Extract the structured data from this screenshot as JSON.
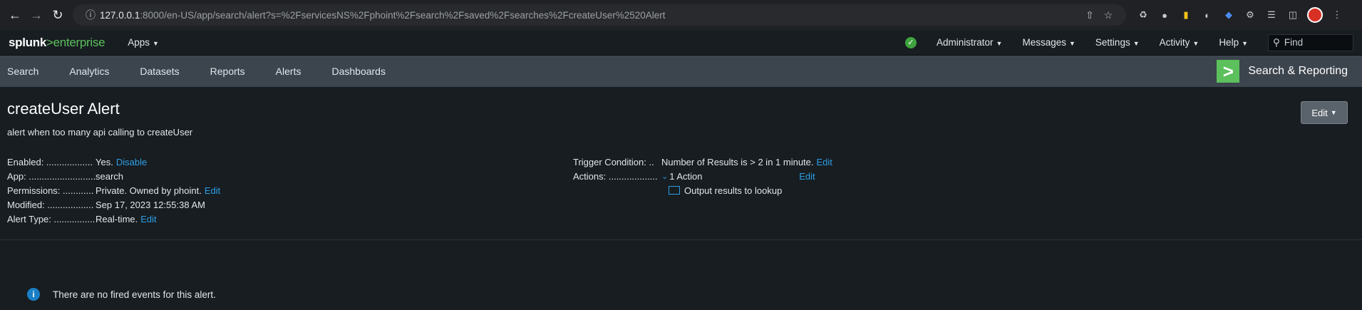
{
  "browser": {
    "url_host": "127.0.0.1",
    "url_rest": ":8000/en-US/app/search/alert?s=%2FservicesNS%2Fphoint%2Fsearch%2Fsaved%2Fsearches%2FcreateUser%2520Alert"
  },
  "splunk_header": {
    "logo_splunk": "splunk",
    "logo_gt": ">",
    "logo_enterprise": "enterprise",
    "apps": "Apps",
    "menus": [
      "Administrator",
      "Messages",
      "Settings",
      "Activity",
      "Help"
    ],
    "find_placeholder": "Find"
  },
  "app_nav": {
    "items": [
      "Search",
      "Analytics",
      "Datasets",
      "Reports",
      "Alerts",
      "Dashboards"
    ],
    "app_name": "Search & Reporting"
  },
  "alert": {
    "title": "createUser Alert",
    "description": "alert when too many api calling to createUser",
    "edit_button": "Edit",
    "left": {
      "enabled_label": "Enabled: ..................",
      "enabled_value": "Yes.",
      "enabled_link": "Disable",
      "app_label": "App: ..........................",
      "app_value": "search",
      "permissions_label": "Permissions: ............",
      "permissions_value": "Private. Owned by phoint.",
      "permissions_link": "Edit",
      "modified_label": "Modified: ..................",
      "modified_value": "Sep 17, 2023 12:55:38 AM",
      "alert_type_label": "Alert Type: ................",
      "alert_type_value": "Real-time.",
      "alert_type_link": "Edit"
    },
    "right": {
      "trigger_label": "Trigger Condition: ..",
      "trigger_value": "Number of Results is > 2 in 1 minute.",
      "trigger_link": "Edit",
      "actions_label": "Actions: ...................",
      "actions_value": "1 Action",
      "actions_link": "Edit",
      "action_item": "Output results to lookup"
    }
  },
  "empty_state": {
    "message": "There are no fired events for this alert."
  }
}
